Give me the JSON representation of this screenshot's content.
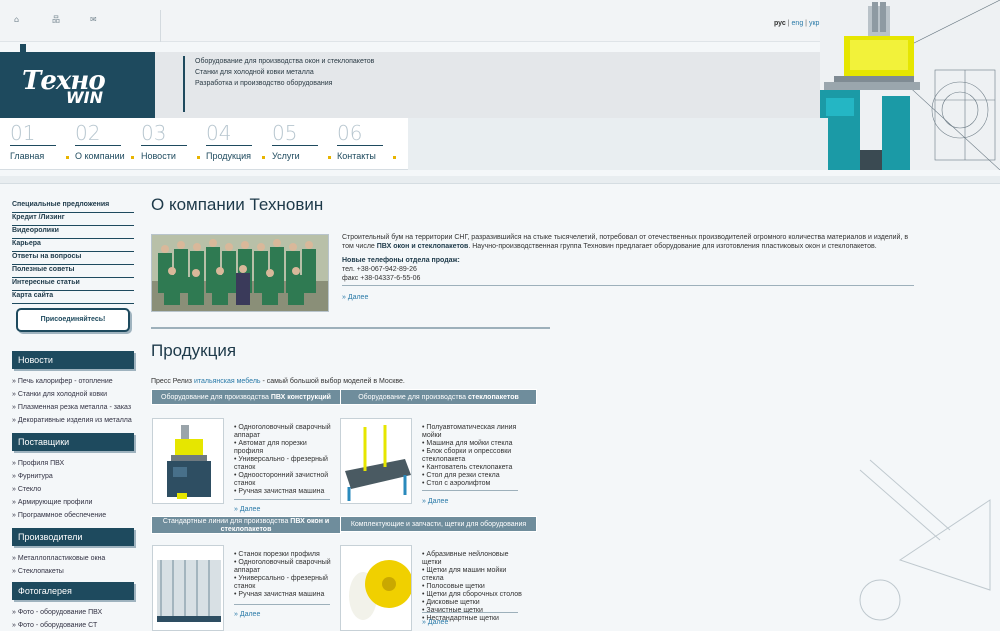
{
  "topbar": {
    "icons": [
      "home-icon",
      "sitemap-icon",
      "mail-icon"
    ],
    "lang": {
      "current": "рус",
      "sep": "|",
      "en": "eng",
      "ua": "укр"
    }
  },
  "header": {
    "logo_word1": "Техно",
    "logo_word2": "WIN",
    "taglines": [
      "Оборудование для производства окон и стеклопакетов",
      "Станки для холодной ковки металла",
      "Разработка и производство оборудования"
    ]
  },
  "nav": [
    {
      "num": "01",
      "label": "Главная"
    },
    {
      "num": "02",
      "label": "О компании"
    },
    {
      "num": "03",
      "label": "Новости"
    },
    {
      "num": "04",
      "label": "Продукция"
    },
    {
      "num": "05",
      "label": "Услуги"
    },
    {
      "num": "06",
      "label": "Контакты"
    }
  ],
  "sidebar": {
    "menu": [
      "Специальные предложения",
      "Кредит /Лизинг",
      "Видеоролики",
      "Карьера",
      "Ответы на вопросы",
      "Полезные советы",
      "Интересные статьи",
      "Карта сайта"
    ],
    "join_label": "Присоединяйтесь!",
    "news": {
      "title": "Новости",
      "items": [
        "» Печь калорифер - отопление",
        "» Станки для холодной ковки",
        "» Плазменная резка металла - заказ",
        "» Декоративные изделия из металла"
      ]
    },
    "suppliers": {
      "title": "Поставщики",
      "items": [
        "» Профиля ПВХ",
        "» Фурнитура",
        "» Стекло",
        "» Армирующие профили",
        "» Программное обеспечение"
      ]
    },
    "producers": {
      "title": "Производители",
      "items": [
        "» Металлопластиковые окна",
        "» Стеклопакеты"
      ]
    },
    "gallery": {
      "title": "Фотогалерея",
      "items": [
        "» Фото - оборудование ПВХ",
        "» Фото - оборудование СТ"
      ]
    }
  },
  "about": {
    "title": "О компании Техновин",
    "text_pre": "Строительный бум на территории СНГ, разразившийся на стыке тысячелетий, потребовал от отечественных производителей огромного количества материалов и изделий, в том числе ",
    "text_bold": "ПВХ окон и стеклопакетов",
    "text_post": ". Научно-производственная группа Техновин предлагает оборудование для изготовления пластиковых окон и стеклопакетов.",
    "phones_title": "Новые телефоны отдела продаж:",
    "phone": "тел.  +38-067-942-89-26",
    "fax": "факс +38-04337-6-55-06",
    "more": "» Далее"
  },
  "products": {
    "title": "Продукция",
    "press_pre": "Пресс Релиз ",
    "press_link": "итальянская мебель",
    "press_post": " - самый большой выбор моделей в Москве.",
    "more": "» Далее",
    "cat1": {
      "pre": "Оборудование для производства ",
      "bold": "ПВХ конструкций",
      "post": ""
    },
    "cat2": {
      "pre": "Оборудование для производства ",
      "bold": "стеклопакетов",
      "post": ""
    },
    "cat3": {
      "pre": "Стандартные линии для производства ",
      "bold": "ПВХ окон и стеклопакетов",
      "post": ""
    },
    "cat4": {
      "pre": "Комплектующие и запчасти, щетки для оборудования",
      "bold": "",
      "post": ""
    },
    "list1": [
      "Одноголовочный сварочный аппарат",
      "Автомат для порезки профиля",
      "Универсально - фрезерный станок",
      "Одноосторонний зачистной станок",
      "Ручная зачистная машина"
    ],
    "list2": [
      "Полуавтоматическая линия мойки",
      "Машина для мойки стекла",
      "Блок сборки и опрессовки стеклопакета",
      "Кантователь стеклопакета",
      "Стол для резки стекла",
      "Стол с аэролифтом"
    ],
    "list3": [
      "Станок порезки профиля",
      "Одноголовочный сварочный аппарат",
      "Универсально - фрезерный станок",
      "Ручная зачистная машина"
    ],
    "list4": [
      "Абразивные нейлоновые щетки",
      "Щетки для машин мойки стекла",
      "Полосовые щетки",
      "Щетки для сборочных столов",
      "Дисковые щетки",
      "Зачистные щетки",
      "Нестандартные щетки"
    ]
  },
  "colors": {
    "brand": "#1e4a5e",
    "accent": "#e8b400",
    "link": "#2a7aa8"
  }
}
